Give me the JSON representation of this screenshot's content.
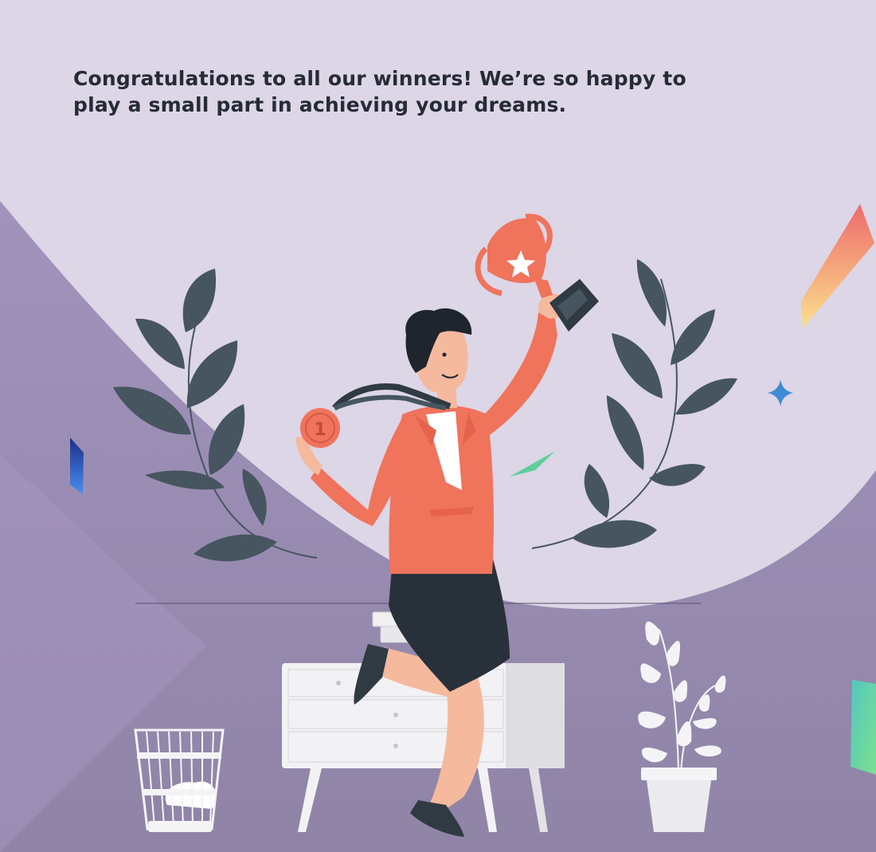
{
  "headline": {
    "line1": "Congratulations to all our winners! We’re so happy to",
    "line2": "play a small part in achieving your dreams."
  },
  "illustration": {
    "medal_number": "1",
    "subject": "woman-celebrating-with-trophy-and-medal",
    "icons": [
      "trophy-icon",
      "medal-icon",
      "laurel-icon",
      "sparkle-icon",
      "plant-icon",
      "wastebasket-icon",
      "dresser-icon"
    ]
  },
  "colors": {
    "background_light": "#dcd6e6",
    "background_purple": "#9788ad",
    "accent_coral": "#f0735c",
    "leaf_dark": "#465560",
    "text_dark": "#262b36",
    "sparkle_blue": "#3d8ad6"
  }
}
